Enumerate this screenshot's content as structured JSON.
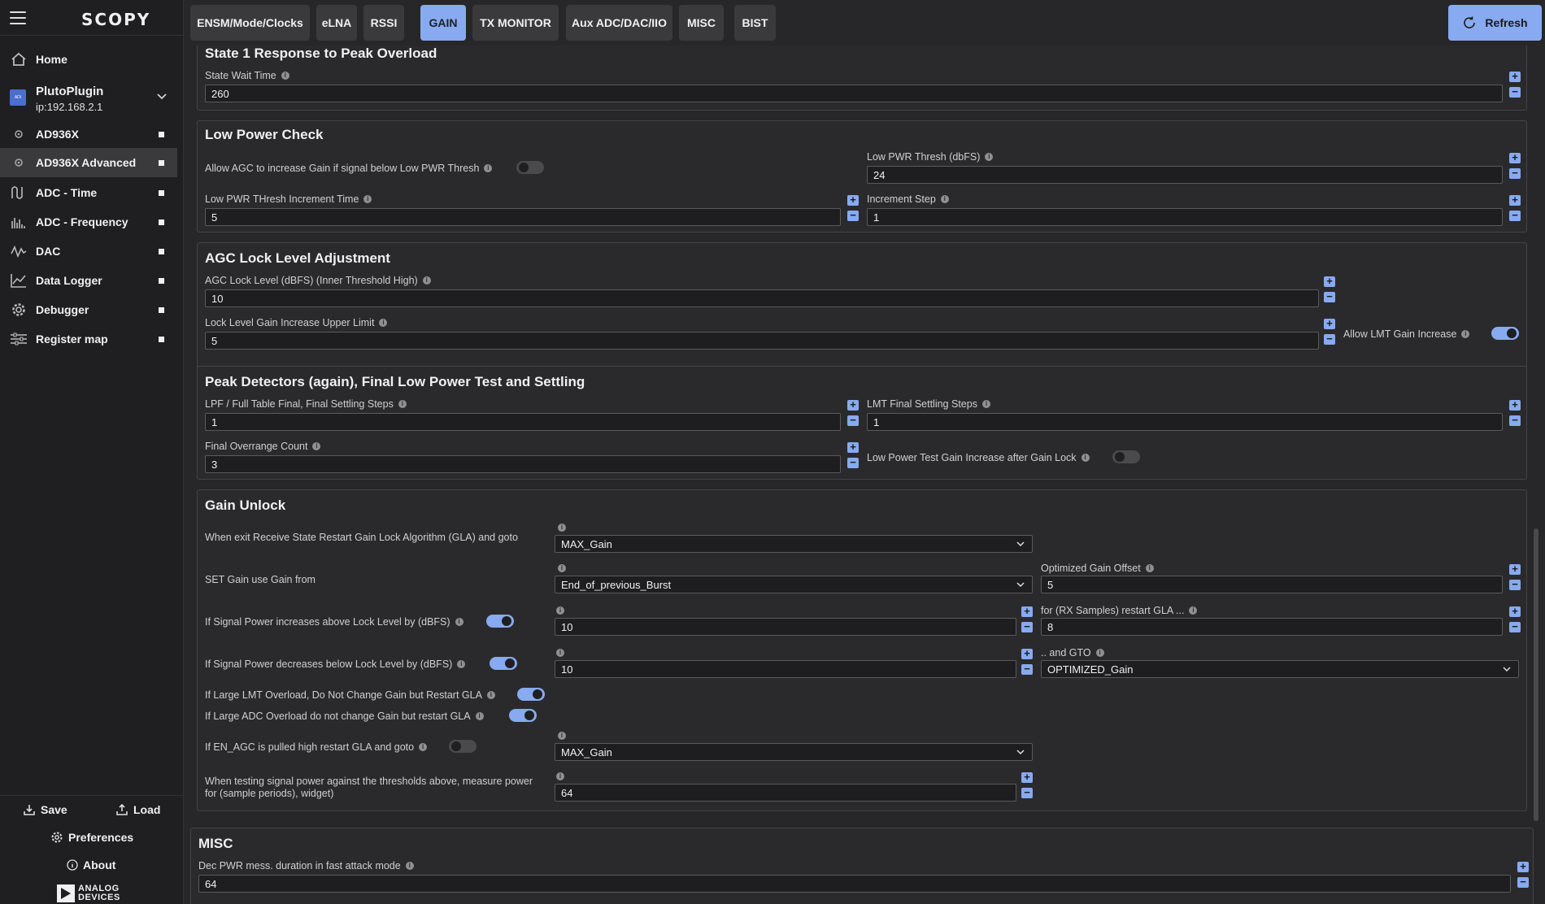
{
  "app": {
    "logo": "SCOPY"
  },
  "sidebar": {
    "home": "Home",
    "plugin": {
      "name": "PlutoPlugin",
      "ip": "ip:192.168.2.1",
      "icon_text": "ANALOG DEVICES"
    },
    "items": [
      {
        "label": "AD936X",
        "icon": "gear-small-icon"
      },
      {
        "label": "AD936X Advanced",
        "icon": "gear-small-icon"
      },
      {
        "label": "ADC - Time",
        "icon": "wave-icon"
      },
      {
        "label": "ADC - Frequency",
        "icon": "spectrum-icon"
      },
      {
        "label": "DAC",
        "icon": "signal-icon"
      },
      {
        "label": "Data Logger",
        "icon": "chart-icon"
      },
      {
        "label": "Debugger",
        "icon": "gear-icon"
      },
      {
        "label": "Register map",
        "icon": "sliders-icon"
      }
    ],
    "save": "Save",
    "load": "Load",
    "preferences": "Preferences",
    "about": "About",
    "brand_line1": "ANALOG",
    "brand_line2": "DEVICES"
  },
  "tabs": [
    "ENSM/Mode/Clocks",
    "eLNA",
    "RSSI",
    "GAIN",
    "TX MONITOR",
    "Aux ADC/DAC/IIO",
    "MISC",
    "BIST"
  ],
  "active_tab": "GAIN",
  "refresh": "Refresh",
  "state1": {
    "title": "State 1 Response to Peak Overload",
    "wait_label": "State Wait Time",
    "wait_value": "260"
  },
  "lowpower": {
    "title": "Low Power Check",
    "allow_label": "Allow AGC to increase Gain if signal below Low PWR Thresh",
    "thresh_label": "Low PWR Thresh (dbFS)",
    "thresh_value": "24",
    "inc_time_label": "Low PWR THresh Increment Time",
    "inc_time_value": "5",
    "inc_step_label": "Increment Step",
    "inc_step_value": "1"
  },
  "agclock": {
    "title": "AGC Lock Level Adjustment",
    "level_label": "AGC Lock Level (dBFS) (Inner Threshold High)",
    "level_value": "10",
    "upper_label": "Lock Level Gain Increase Upper Limit",
    "upper_value": "5",
    "lmt_label": "Allow LMT Gain Increase"
  },
  "peak": {
    "title": "Peak Detectors (again), Final Low Power Test and Settling",
    "lpf_label": "LPF / Full Table Final, Final Settling Steps",
    "lpf_value": "1",
    "lmt_label": "LMT Final Settling Steps",
    "lmt_value": "1",
    "overrange_label": "Final Overrange Count",
    "overrange_value": "3",
    "lowpower_label": "Low Power Test Gain Increase after Gain Lock"
  },
  "unlock": {
    "title": "Gain Unlock",
    "exit_label": "When exit Receive State Restart Gain Lock Algorithm (GLA) and goto",
    "exit_value": "MAX_Gain",
    "setgain_label": "SET Gain use Gain from",
    "setgain_value": "End_of_previous_Burst",
    "offset_label": "Optimized Gain Offset",
    "offset_value": "5",
    "above_label": "If Signal Power increases above Lock Level by (dBFS)",
    "above_value": "10",
    "rxsamples_label": "for (RX Samples) restart GLA ...",
    "rxsamples_value": "8",
    "below_label": "If Signal Power decreases below Lock Level by (dBFS)",
    "below_value": "10",
    "gto_label": ".. and GTO",
    "gto_value": "OPTIMIZED_Gain",
    "lmt_overload_label": "If Large LMT Overload, Do Not Change Gain but Restart GLA",
    "adc_overload_label": "If Large ADC Overload do not change Gain but restart GLA",
    "enagc_label": "If EN_AGC is pulled high restart GLA and goto",
    "enagc_value": "MAX_Gain",
    "measure_label1": "When testing signal power against the thresholds above, measure power",
    "measure_label2": "for (sample periods), widget)",
    "measure_value": "64"
  },
  "misc": {
    "title": "MISC",
    "dec_label": "Dec PWR mess. duration in fast attack mode",
    "dec_value": "64"
  }
}
